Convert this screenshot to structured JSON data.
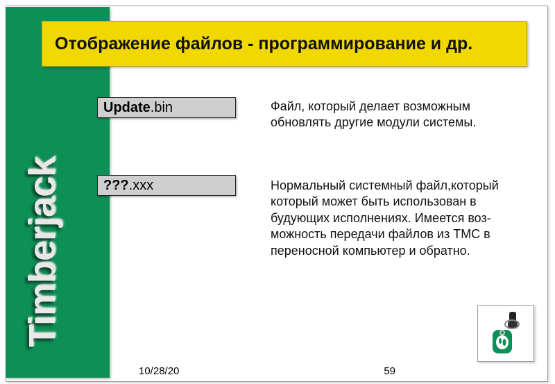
{
  "brand": "Timberjack",
  "title": "Отображение файлов - программирование и др.",
  "files": [
    {
      "name_bold": "Update",
      "name_rest": ".bin",
      "desc": "Файл, который делает возможным обновлять другие модули системы."
    },
    {
      "name_bold": "???",
      "name_rest": ".xxx",
      "desc": "Нормальный системный файл,который который может быть использован в будующих исполнениях. Имеется воз-можность передачи файлов из TMC в переносной компьютер и обратно."
    }
  ],
  "footer": {
    "date": "10/28/20",
    "page": "59"
  },
  "icons": {
    "key": "key-fob-icon"
  }
}
